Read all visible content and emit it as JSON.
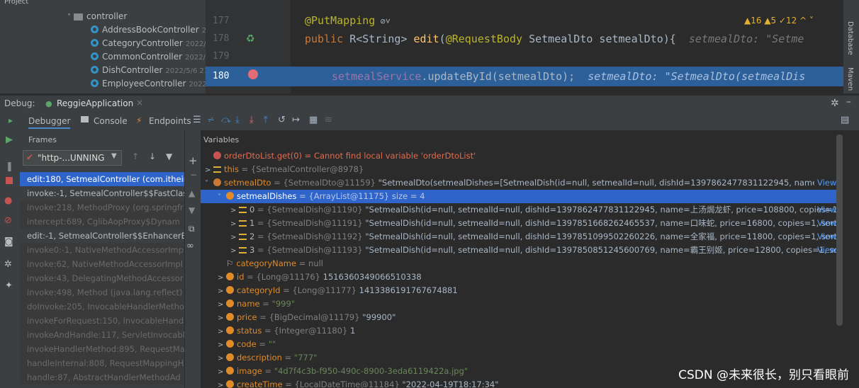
{
  "project": {
    "header": "Project",
    "folder": "controller",
    "items": [
      {
        "name": "AddressBookController",
        "date": "202"
      },
      {
        "name": "CategoryController",
        "date": "2022/4/"
      },
      {
        "name": "CommonController",
        "date": "2022/4/"
      },
      {
        "name": "DishController",
        "date": "2022/5/6 21:"
      },
      {
        "name": "EmployeeController",
        "date": "2022/4"
      }
    ]
  },
  "editor": {
    "line_numbers": [
      "177",
      "178",
      "179",
      "180"
    ],
    "line177_ann": "@PutMapping",
    "line178_kw": "public",
    "line178_type": " R<String> ",
    "line178_fn": "edit",
    "line178_params_a": "(",
    "line178_params_ann": "@RequestBody",
    "line178_params_b": " SetmealDto setmealDto){",
    "line178_inline": "  setmealDto: \"Setme",
    "line180_mem": "setmealService",
    "line180_call": ".updateById(setmealDto);",
    "line180_inline": "  setmealDto: \"SetmealDto(setmealDis",
    "warnings": "▲16  ▲5  ✓12  ^  ˅"
  },
  "debug": {
    "label": "Debug:",
    "config": "ReggieApplication",
    "tabs": {
      "debugger": "Debugger",
      "console": "Console",
      "endpoints": "Endpoints"
    },
    "frames_header": "Frames",
    "variables_header": "Variables",
    "thread_select": "\"http-...UNNING",
    "frames": [
      {
        "text": "edit:180, SetmealController (com.itheir",
        "kind": "sel"
      },
      {
        "text": "invoke:-1, SetmealController$$FastClas",
        "kind": "user"
      },
      {
        "text": "invoke:218, MethodProxy (org.springfr",
        "kind": "lib"
      },
      {
        "text": "intercept:689, CglibAopProxy$Dynam",
        "kind": "lib"
      },
      {
        "text": "edit:-1, SetmealController$$EnhancerB",
        "kind": "user"
      },
      {
        "text": "invoke0:-1, NativeMethodAccessorImp",
        "kind": "lib"
      },
      {
        "text": "invoke:62, NativeMethodAccessorImpl",
        "kind": "lib"
      },
      {
        "text": "invoke:43, DelegatingMethodAccessor",
        "kind": "lib"
      },
      {
        "text": "invoke:498, Method (java.lang.reflect)",
        "kind": "lib"
      },
      {
        "text": "doInvoke:205, InvocableHandlerMetho",
        "kind": "lib"
      },
      {
        "text": "invokeForRequest:150, InvocableHandl",
        "kind": "lib"
      },
      {
        "text": "invokeAndHandle:117, ServletInvocabl",
        "kind": "lib"
      },
      {
        "text": "invokeHandlerMethod:895, RequestMa",
        "kind": "lib"
      },
      {
        "text": "handleInternal:808, RequestMappingH",
        "kind": "lib"
      },
      {
        "text": "handle:87, AbstractHandlerMethodAd",
        "kind": "lib"
      }
    ],
    "variables": [
      {
        "indent": 0,
        "arrow": "",
        "icon": "red",
        "name": "orderDtoList.get(0) = Cannot find local variable 'orderDtoList'",
        "type": "",
        "value": "",
        "view": "",
        "nameClass": "err"
      },
      {
        "indent": 0,
        "arrow": ">",
        "icon": "eq",
        "name": "this",
        "type": " = {SetmealController@8978}",
        "value": "",
        "view": ""
      },
      {
        "indent": 0,
        "arrow": "˅",
        "icon": "p",
        "name": "setmealDto",
        "type": " = {SetmealDto@11159} ",
        "value": "\"SetmealDto(setmealDishes=[SetmealDish(id=null, setmealId=null, dishId=1397862477831122945, name=上汤焗...",
        "view": "View"
      },
      {
        "indent": 1,
        "arrow": "˅",
        "icon": "f",
        "name": "setmealDishes",
        "type": " = {ArrayList@11175}  size = 4",
        "value": "",
        "view": "",
        "sel": true
      },
      {
        "indent": 2,
        "arrow": ">",
        "icon": "eq",
        "name": "0",
        "type": " = {SetmealDish@11190} ",
        "value": "\"SetmealDish(id=null, setmealId=null, dishId=1397862477831122945, name=上汤焗龙虾, price=108800, copies=1, s...",
        "view": "View"
      },
      {
        "indent": 2,
        "arrow": ">",
        "icon": "eq",
        "name": "1",
        "type": " = {SetmealDish@11191} ",
        "value": "\"SetmealDish(id=null, setmealId=null, dishId=1397851668262465537, name=口味蛇, price=16800, copies=1, sort=n...",
        "view": "View"
      },
      {
        "indent": 2,
        "arrow": ">",
        "icon": "eq",
        "name": "2",
        "type": " = {SetmealDish@11192} ",
        "value": "\"SetmealDish(id=null, setmealId=null, dishId=1397851099502260226, name=全家福, price=11800, copies=1, sort=n...",
        "view": "View"
      },
      {
        "indent": 2,
        "arrow": ">",
        "icon": "eq",
        "name": "3",
        "type": " = {SetmealDish@11193} ",
        "value": "\"SetmealDish(id=null, setmealId=null, dishId=1397850851245600769, name=霸王别姬, price=12800, copies=1, sort-...",
        "view": "View"
      },
      {
        "indent": 1,
        "arrow": "",
        "icon": "flag",
        "name": "categoryName",
        "type": " = null",
        "value": "",
        "view": ""
      },
      {
        "indent": 1,
        "arrow": ">",
        "icon": "f",
        "name": "id",
        "type": " = {Long@11176} ",
        "value": "1516360349066510338",
        "view": ""
      },
      {
        "indent": 1,
        "arrow": ">",
        "icon": "f",
        "name": "categoryId",
        "type": " = {Long@11177} ",
        "value": "1413386191767674881",
        "view": ""
      },
      {
        "indent": 1,
        "arrow": ">",
        "icon": "f",
        "name": "name",
        "type": " = ",
        "value": "\"999\"",
        "view": "",
        "str": true
      },
      {
        "indent": 1,
        "arrow": ">",
        "icon": "f",
        "name": "price",
        "type": " = {BigDecimal@11179} ",
        "value": "\"99900\"",
        "view": ""
      },
      {
        "indent": 1,
        "arrow": ">",
        "icon": "f",
        "name": "status",
        "type": " = {Integer@11180} ",
        "value": "1",
        "view": ""
      },
      {
        "indent": 1,
        "arrow": ">",
        "icon": "f",
        "name": "code",
        "type": " = ",
        "value": "\"\"",
        "view": "",
        "str": true
      },
      {
        "indent": 1,
        "arrow": ">",
        "icon": "f",
        "name": "description",
        "type": " = ",
        "value": "\"777\"",
        "view": "",
        "str": true
      },
      {
        "indent": 1,
        "arrow": ">",
        "icon": "f",
        "name": "image",
        "type": " = ",
        "value": "\"4d7f4c3b-f950-490c-8900-3eda6119422a.jpg\"",
        "view": "",
        "str": true
      },
      {
        "indent": 1,
        "arrow": ">",
        "icon": "f",
        "name": "createTime",
        "type": " = {LocalDateTime@11184} ",
        "value": "\"2022-04-19T18:17:34\"",
        "view": ""
      }
    ]
  },
  "side_labels": {
    "database": "Database",
    "maven": "Maven"
  },
  "watermark": "CSDN @未来很长，别只看眼前"
}
